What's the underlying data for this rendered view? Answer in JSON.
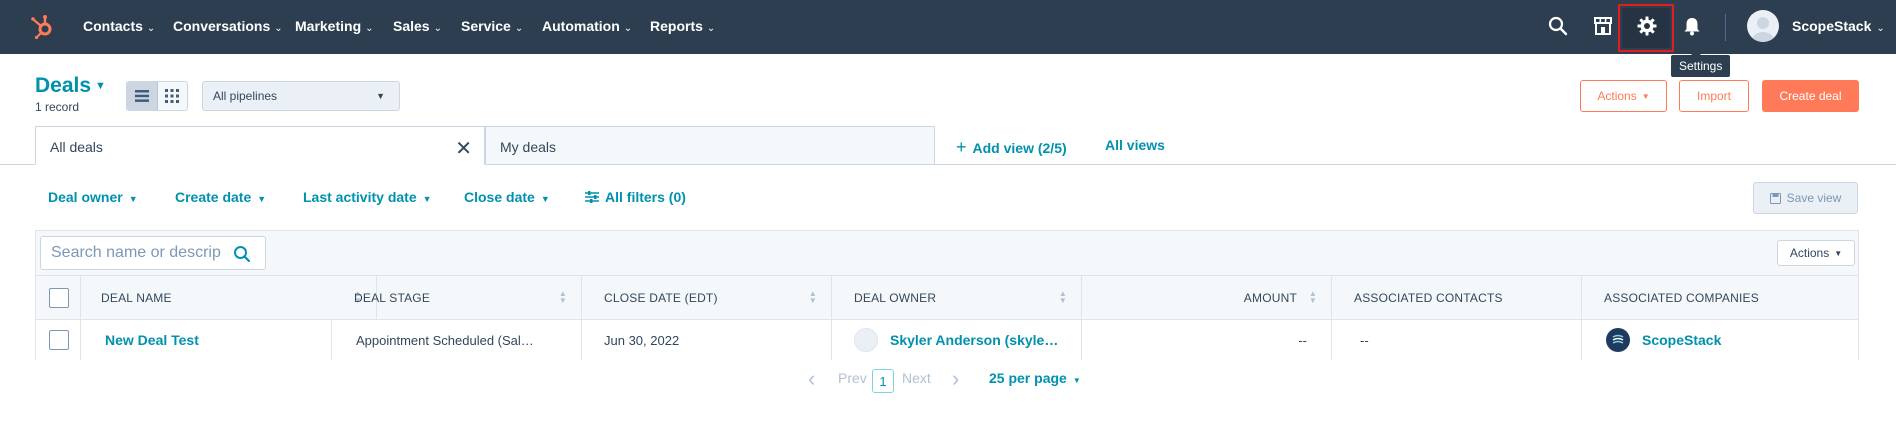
{
  "nav": {
    "items": [
      {
        "label": "Contacts"
      },
      {
        "label": "Conversations"
      },
      {
        "label": "Marketing"
      },
      {
        "label": "Sales"
      },
      {
        "label": "Service"
      },
      {
        "label": "Automation"
      },
      {
        "label": "Reports"
      }
    ],
    "account": "ScopeStack",
    "settings_tooltip": "Settings",
    "icons": [
      "search-icon",
      "marketplace-icon",
      "gear-icon",
      "bell-icon"
    ]
  },
  "header": {
    "title": "Deals",
    "record_count": "1 record",
    "pipeline_value": "All pipelines",
    "actions_label": "Actions",
    "import_label": "Import",
    "create_label": "Create deal"
  },
  "tabs": [
    {
      "label": "All deals",
      "active": true
    },
    {
      "label": "My deals",
      "active": false
    }
  ],
  "view_links": {
    "add_view": "Add view (2/5)",
    "all_views": "All views"
  },
  "filters": {
    "deal_owner": "Deal owner",
    "create_date": "Create date",
    "last_activity": "Last activity date",
    "close_date": "Close date",
    "all_filters": "All filters (0)",
    "save_view": "Save view"
  },
  "table": {
    "search_placeholder": "Search name or description",
    "actions_label": "Actions",
    "columns": [
      "DEAL NAME",
      "DEAL STAGE",
      "CLOSE DATE (EDT)",
      "DEAL OWNER",
      "AMOUNT",
      "ASSOCIATED CONTACTS",
      "ASSOCIATED COMPANIES"
    ],
    "rows": [
      {
        "deal_name": "New Deal Test",
        "deal_stage": "Appointment Scheduled (Sal…",
        "close_date": "Jun 30, 2022",
        "deal_owner": "Skyler Anderson (skyle…",
        "amount": "--",
        "contacts": "--",
        "company": "ScopeStack"
      }
    ]
  },
  "pagination": {
    "prev": "Prev",
    "page": "1",
    "next": "Next",
    "per_page": "25 per page"
  },
  "colors": {
    "nav_bg": "#2d3e50",
    "link": "#0091ae",
    "accent": "#ff7a59",
    "highlight_box": "#e11d1d"
  }
}
